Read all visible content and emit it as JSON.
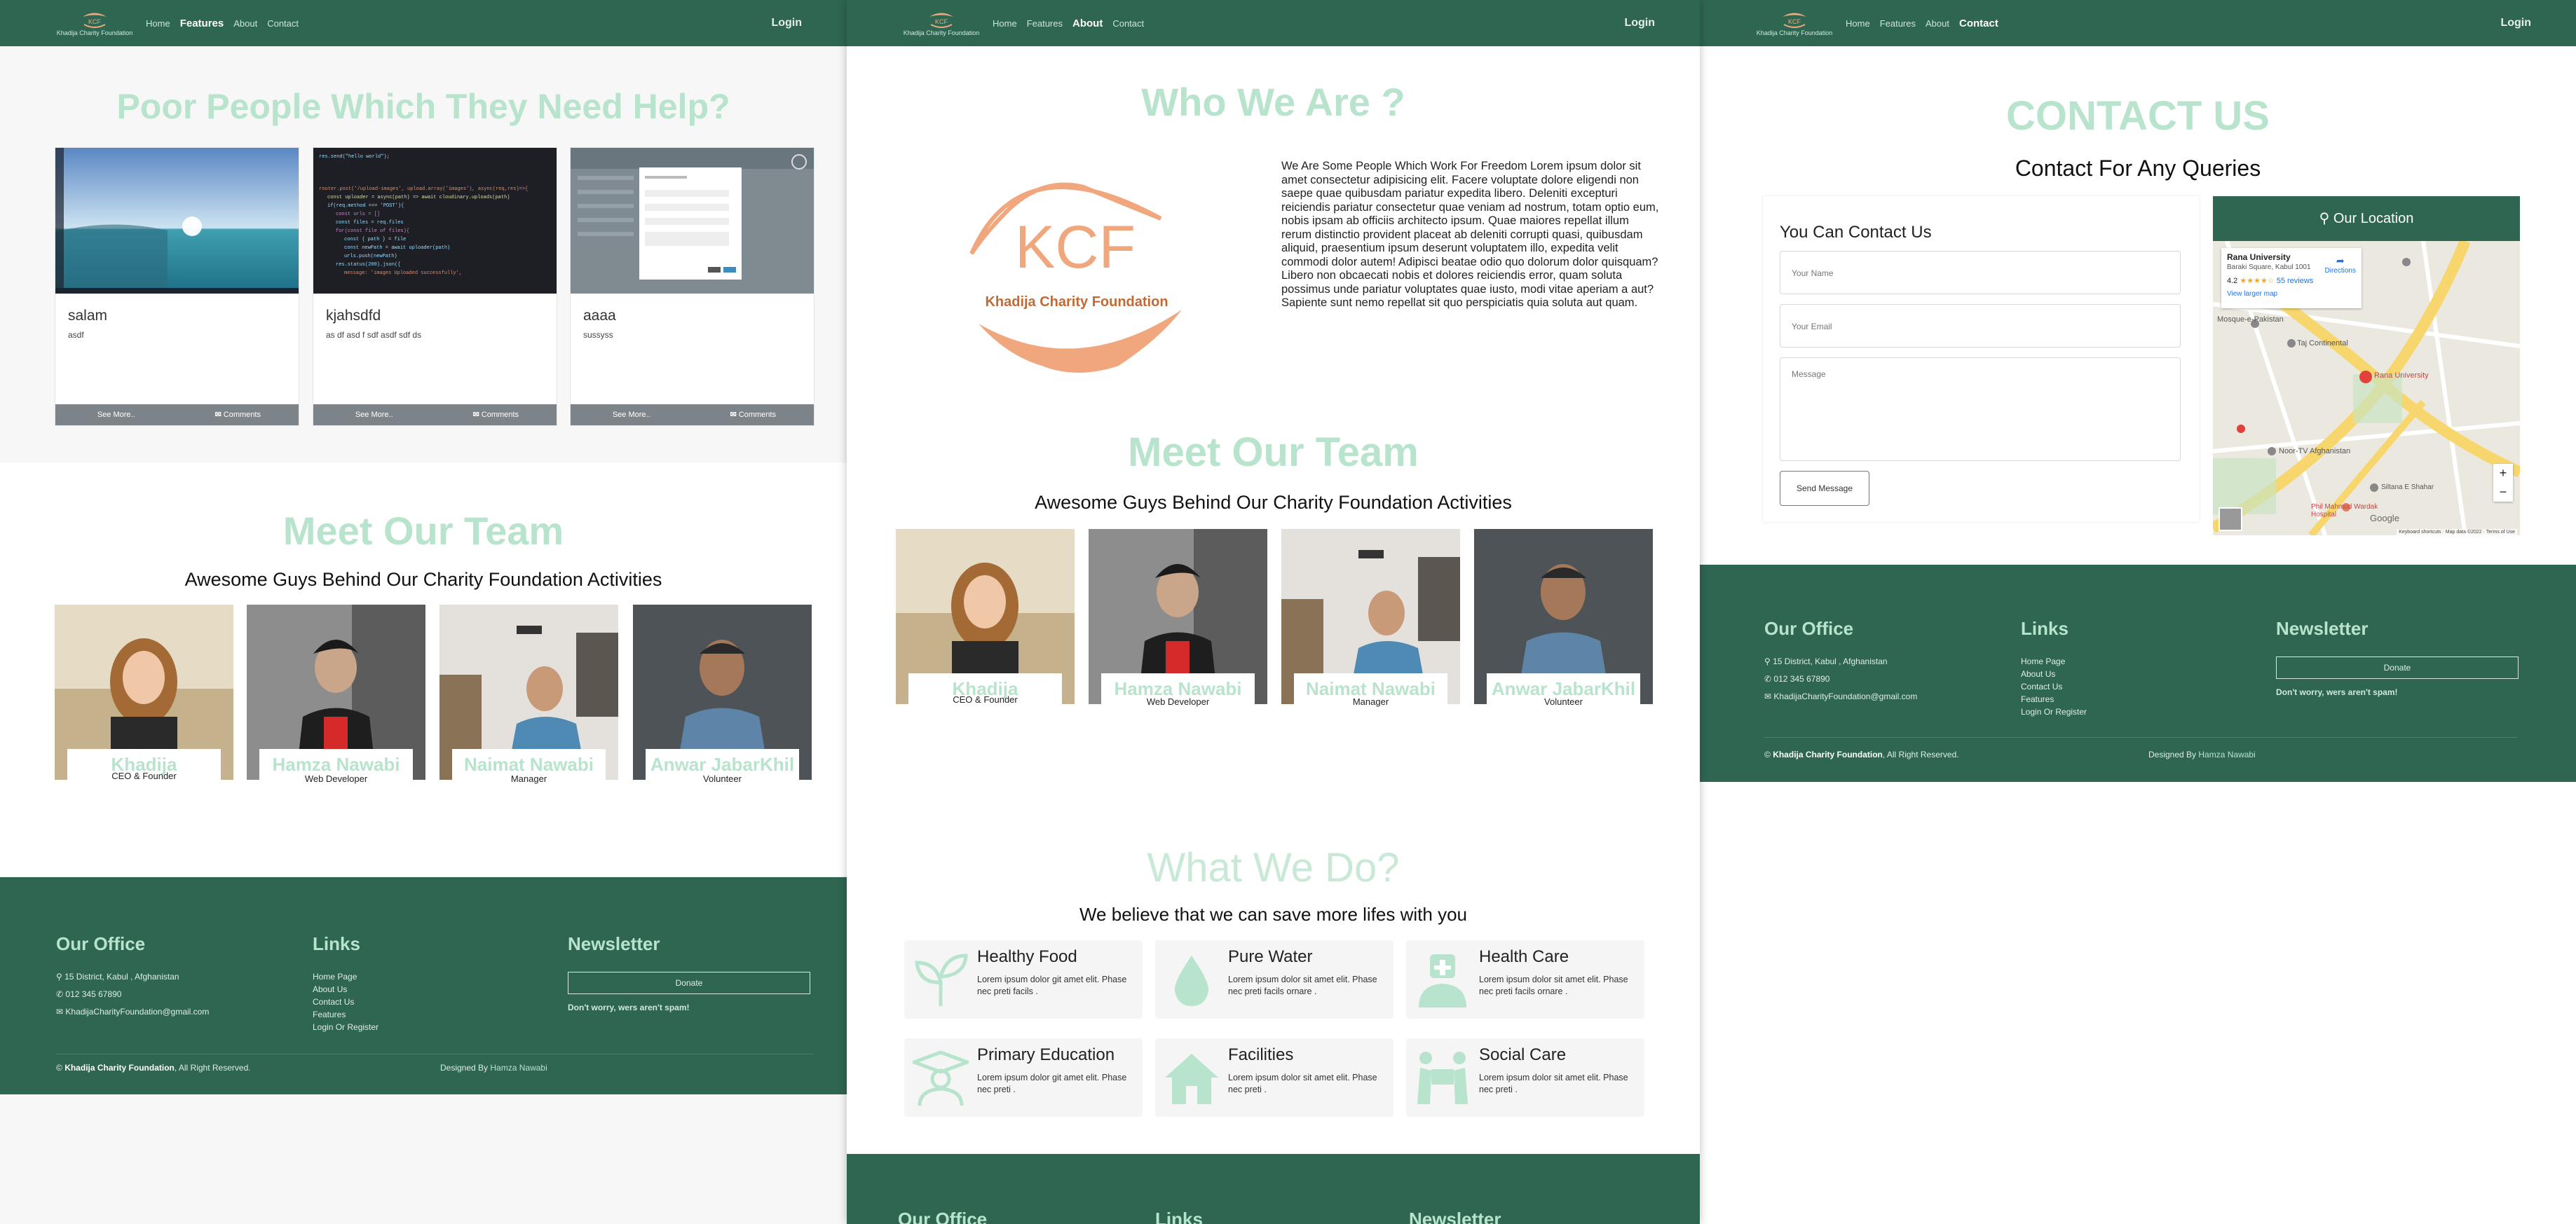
{
  "nav": {
    "logo_text": "Khadija Charity Foundation",
    "links": [
      "Home",
      "Features",
      "About",
      "Contact"
    ],
    "login": "Login"
  },
  "features": {
    "heading": "Poor People Which They Need Help?",
    "cards": [
      {
        "title": "salam",
        "desc": "asdf",
        "see_more": "See More..",
        "comments": "Comments"
      },
      {
        "title": "kjahsdfd",
        "desc": "as df asd f sdf asdf sdf ds",
        "see_more": "See More..",
        "comments": "Comments"
      },
      {
        "title": "aaaa",
        "desc": "sussyss",
        "see_more": "See More..",
        "comments": "Comments"
      }
    ]
  },
  "team": {
    "heading": "Meet Our Team",
    "subheading": "Awesome Guys Behind Our Charity Foundation Activities",
    "members": [
      {
        "name": "Khadija Heiderzada",
        "role": "CEO & Founder"
      },
      {
        "name": "Hamza Nawabi",
        "role": "Web Developer"
      },
      {
        "name": "Naimat Nawabi",
        "role": "Manager"
      },
      {
        "name": "Anwar JabarKhil",
        "role": "Volunteer"
      }
    ]
  },
  "footer": {
    "office_title": "Our Office",
    "address": "15 District, Kabul , Afghanistan",
    "phone": "012 345 67890",
    "email": "KhadijaCharityFoundation@gmail.com",
    "links_title": "Links",
    "links": [
      "Home Page",
      "About Us",
      "Contact Us",
      "Features",
      "Login Or Register"
    ],
    "newsletter_title": "Newsletter",
    "donate": "Donate",
    "spam_note": "Don't worry, wers aren't spam!",
    "copyright_prefix": "©",
    "copyright_brand": "Khadija Charity Foundation",
    "copyright_suffix": ", All Right Reserved.",
    "designed_by_label": "Designed By",
    "designer": "Hamza Nawabi"
  },
  "about": {
    "heading": "Who We Are ?",
    "logo_letters": "KCF",
    "logo_caption": "Khadija Charity Foundation",
    "text": "We Are Some People Which Work For Freedom Lorem ipsum dolor sit amet consectetur adipisicing elit. Facere voluptate dolore eligendi non saepe quae quibusdam pariatur expedita libero. Deleniti excepturi reiciendis pariatur consectetur quae veniam ad nostrum, totam optio eum, nobis ipsam ab officiis architecto ipsum. Quae maiores repellat illum rerum distinctio provident placeat ab deleniti corrupti quasi, quibusdam aliquid, praesentium ipsum deserunt voluptatem illo, expedita velit commodi dolor autem! Adipisci beatae odio quo dolorum dolor quisquam? Libero non obcaecati nobis et dolores reiciendis error, quam soluta possimus unde pariatur voluptates quae iusto, modi vitae aperiam a aut? Sapiente sunt nemo repellat sit quo perspiciatis quia soluta aut quam."
  },
  "services": {
    "heading": "What We Do?",
    "subheading": "We believe that we can save more lifes with you",
    "items": [
      {
        "title": "Healthy Food",
        "desc": "Lorem ipsum dolor git amet elit. Phase nec preti facils .",
        "icon": "plant-icon"
      },
      {
        "title": "Pure Water",
        "desc": "Lorem ipsum dolor sit amet elit. Phase nec preti facils ornare .",
        "icon": "water-drop-icon"
      },
      {
        "title": "Health Care",
        "desc": "Lorem ipsum dolor sit amet elit. Phase nec preti facils ornare .",
        "icon": "doctor-icon"
      },
      {
        "title": "Primary Education",
        "desc": "Lorem ipsum dolor git amet elit. Phase nec preti .",
        "icon": "graduate-icon"
      },
      {
        "title": "Facilities",
        "desc": "Lorem ipsum dolor sit amet elit. Phase nec preti .",
        "icon": "house-icon"
      },
      {
        "title": "Social Care",
        "desc": "Lorem ipsum dolor sit amet elit. Phase nec preti .",
        "icon": "social-care-icon"
      }
    ]
  },
  "contact": {
    "heading": "CONTACT US",
    "subheading": "Contact For Any Queries",
    "form_title": "You Can Contact Us",
    "name_placeholder": "Your Name",
    "email_placeholder": "Your Email",
    "message_placeholder": "Message",
    "send": "Send Message",
    "location_title": "Our Location",
    "map": {
      "place": "Rana University",
      "address": "Baraki Square, Kabul 1001",
      "rating": "4.2",
      "stars": "★★★★☆",
      "reviews": "55 reviews",
      "larger": "View larger map",
      "directions": "Directions",
      "labels": [
        "Mosque-e-Pakistan",
        "Taj Continental",
        "Rana University",
        "Noor-TV Afghanistan",
        "Phil Mahmud Wardak Hospital",
        "Siltana E Shahar",
        "Google"
      ],
      "zoom_in": "+",
      "zoom_out": "−",
      "footer": [
        "Keyboard shortcuts",
        "Map data ©2022",
        "Terms of Use"
      ]
    }
  },
  "colors": {
    "primary": "#2e6651",
    "accent": "#b8e3cc",
    "button_gray": "#7d8489",
    "logo_orange": "#f1a77d"
  }
}
